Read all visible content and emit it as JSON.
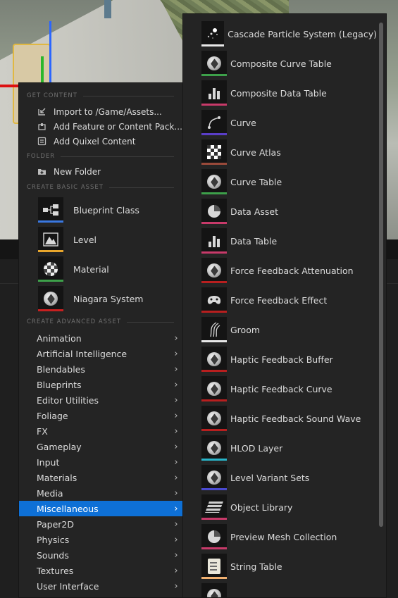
{
  "colors": {
    "accent_active": "#0e70d6",
    "bar_blueprint": "#3a78e0",
    "bar_level": "#e8a62c",
    "bar_material": "#3da04a",
    "bar_niagara": "#c82020",
    "bar_particle": "#e8e8e8",
    "bar_green": "#3da04a",
    "bar_purple": "#5a3ec8",
    "bar_brown": "#9a4a3a",
    "bar_pink": "#c83a6a",
    "bar_red": "#b81f1f",
    "bar_cyan": "#28b4c8",
    "bar_indigo": "#4a4ad0",
    "bar_peach": "#f0b070"
  },
  "left_menu": {
    "sections": {
      "get_content": "GET CONTENT",
      "folder": "FOLDER",
      "create_basic_asset": "CREATE BASIC ASSET",
      "create_advanced_asset": "CREATE ADVANCED ASSET"
    },
    "get_content_items": [
      {
        "label": "Import to /Game/Assets...",
        "icon": "import-icon"
      },
      {
        "label": "Add Feature or Content Pack...",
        "icon": "content-pack-icon"
      },
      {
        "label": "Add Quixel Content",
        "icon": "quixel-icon"
      }
    ],
    "folder_items": [
      {
        "label": "New Folder",
        "icon": "new-folder-icon"
      }
    ],
    "basic_assets": [
      {
        "label": "Blueprint Class",
        "icon": "blueprint-class-icon"
      },
      {
        "label": "Level",
        "icon": "level-icon"
      },
      {
        "label": "Material",
        "icon": "material-icon"
      },
      {
        "label": "Niagara System",
        "icon": "niagara-system-icon"
      }
    ],
    "advanced_categories": [
      "Animation",
      "Artificial Intelligence",
      "Blendables",
      "Blueprints",
      "Editor Utilities",
      "Foliage",
      "FX",
      "Gameplay",
      "Input",
      "Materials",
      "Media",
      "Miscellaneous",
      "Paper2D",
      "Physics",
      "Sounds",
      "Textures",
      "User Interface"
    ],
    "active_category": "Miscellaneous"
  },
  "right_menu": {
    "items": [
      {
        "label": "Cascade Particle System (Legacy)",
        "icon": "particle-system-icon"
      },
      {
        "label": "Composite Curve Table",
        "icon": "composite-curve-table-icon"
      },
      {
        "label": "Composite Data Table",
        "icon": "composite-data-table-icon"
      },
      {
        "label": "Curve",
        "icon": "curve-icon"
      },
      {
        "label": "Curve Atlas",
        "icon": "curve-atlas-icon"
      },
      {
        "label": "Curve Table",
        "icon": "curve-table-icon"
      },
      {
        "label": "Data Asset",
        "icon": "data-asset-icon"
      },
      {
        "label": "Data Table",
        "icon": "data-table-icon"
      },
      {
        "label": "Force Feedback Attenuation",
        "icon": "force-feedback-attenuation-icon"
      },
      {
        "label": "Force Feedback Effect",
        "icon": "force-feedback-effect-icon"
      },
      {
        "label": "Groom",
        "icon": "groom-icon"
      },
      {
        "label": "Haptic Feedback Buffer",
        "icon": "haptic-feedback-buffer-icon"
      },
      {
        "label": "Haptic Feedback Curve",
        "icon": "haptic-feedback-curve-icon"
      },
      {
        "label": "Haptic Feedback Sound Wave",
        "icon": "haptic-feedback-sound-wave-icon"
      },
      {
        "label": "HLOD Layer",
        "icon": "hlod-layer-icon"
      },
      {
        "label": "Level Variant Sets",
        "icon": "level-variant-sets-icon"
      },
      {
        "label": "Object Library",
        "icon": "object-library-icon"
      },
      {
        "label": "Preview Mesh Collection",
        "icon": "preview-mesh-collection-icon"
      },
      {
        "label": "String Table",
        "icon": "string-table-icon"
      }
    ]
  }
}
